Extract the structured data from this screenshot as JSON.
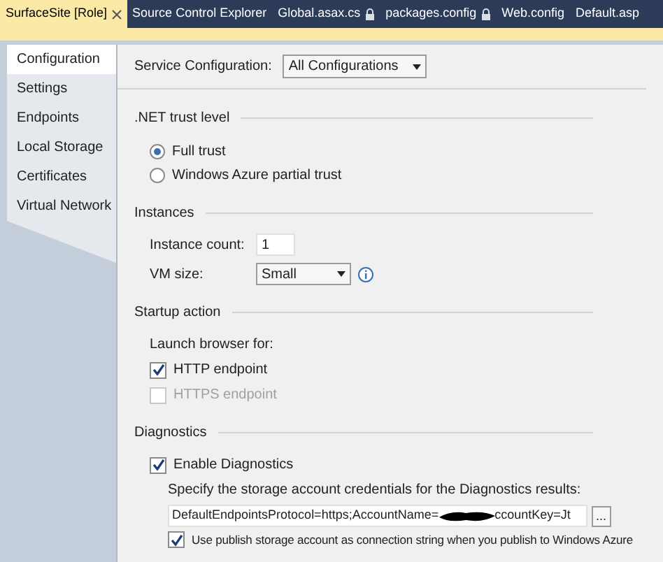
{
  "doc_tabs": [
    {
      "label": "SurfaceSite [Role]",
      "selected": true,
      "locked": false
    },
    {
      "label": "Source Control Explorer",
      "selected": false,
      "locked": false
    },
    {
      "label": "Global.asax.cs",
      "selected": false,
      "locked": true
    },
    {
      "label": "packages.config",
      "selected": false,
      "locked": true
    },
    {
      "label": "Web.config",
      "selected": false,
      "locked": false
    },
    {
      "label": "Default.asp",
      "selected": false,
      "locked": false
    }
  ],
  "side_tabs": [
    {
      "label": "Configuration",
      "selected": true
    },
    {
      "label": "Settings",
      "selected": false
    },
    {
      "label": "Endpoints",
      "selected": false
    },
    {
      "label": "Local Storage",
      "selected": false
    },
    {
      "label": "Certificates",
      "selected": false
    },
    {
      "label": "Virtual Network",
      "selected": false
    }
  ],
  "service_configuration": {
    "label": "Service Configuration:",
    "value": "All Configurations"
  },
  "trust": {
    "title": ".NET trust level",
    "options": [
      {
        "label": "Full trust",
        "selected": true
      },
      {
        "label": "Windows Azure partial trust",
        "selected": false
      }
    ]
  },
  "instances": {
    "title": "Instances",
    "count_label": "Instance count:",
    "count": "1",
    "vm_label": "VM size:",
    "vm_value": "Small"
  },
  "startup": {
    "title": "Startup action",
    "label": "Launch browser for:",
    "options": [
      {
        "label": "HTTP endpoint",
        "checked": true,
        "disabled": false
      },
      {
        "label": "HTTPS endpoint",
        "checked": false,
        "disabled": true
      }
    ]
  },
  "diagnostics": {
    "title": "Diagnostics",
    "enable": {
      "label": "Enable Diagnostics",
      "checked": true
    },
    "hint": "Specify the storage account credentials for the Diagnostics results:",
    "value_before": "DefaultEndpointsProtocol=https;AccountName=",
    "value_after": "ccountKey=Jt",
    "browse": "...",
    "publish": {
      "label": "Use publish storage account as connection string when you publish to Windows Azure",
      "checked": true
    }
  }
}
